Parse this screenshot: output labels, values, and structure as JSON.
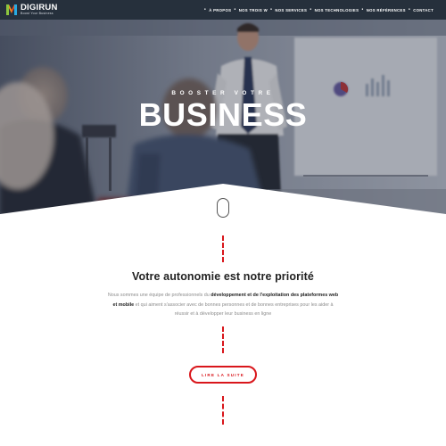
{
  "header": {
    "logo_name": "DIGIRUN",
    "logo_tagline": "Boost Your Business",
    "nav": [
      {
        "label": "À PROPOS"
      },
      {
        "label": "NOS TROIS W"
      },
      {
        "label": "NOS SERVICES"
      },
      {
        "label": "NOS TECHNOLOGIES"
      },
      {
        "label": "NOS RÉFÉRENCES"
      },
      {
        "label": "CONTACT"
      }
    ]
  },
  "hero": {
    "subtitle": "BOOSTER VOTRE",
    "title": "BUSINESS",
    "scroll_icon": "mouse-scroll-icon"
  },
  "intro": {
    "title": "Votre autonomie est notre priorité",
    "text_1": "Nous sommes une équipe de professionnels du ",
    "text_bold_1": "développement et de l'exploitation des plateformes web et mobile",
    "text_2": " et qui aiment s'associer avec de bonnes personnes et de bonnes entreprises pour les aider à réussir et à développer leur business en ligne",
    "cta_label": "LIRE LA SUITE"
  },
  "colors": {
    "nav_bg": "#26303c",
    "accent": "#d9161b",
    "text_dark": "#222222",
    "text_muted": "#8c8c8c"
  }
}
